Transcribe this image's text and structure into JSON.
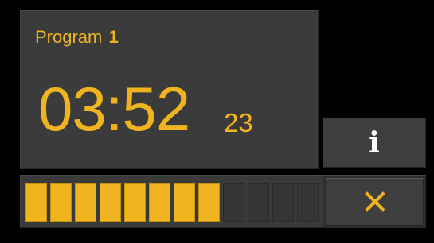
{
  "program": {
    "label": "Program",
    "number": "1"
  },
  "timer": {
    "main": "03:52",
    "sub": "23"
  },
  "progress": {
    "total_segments": 12,
    "filled_segments": 8,
    "fraction": 0.667
  },
  "buttons": {
    "info_label": "i",
    "cancel_icon": "close-icon"
  },
  "colors": {
    "accent": "#f0b41e",
    "panel": "#3b3b3b",
    "background": "#000000"
  }
}
